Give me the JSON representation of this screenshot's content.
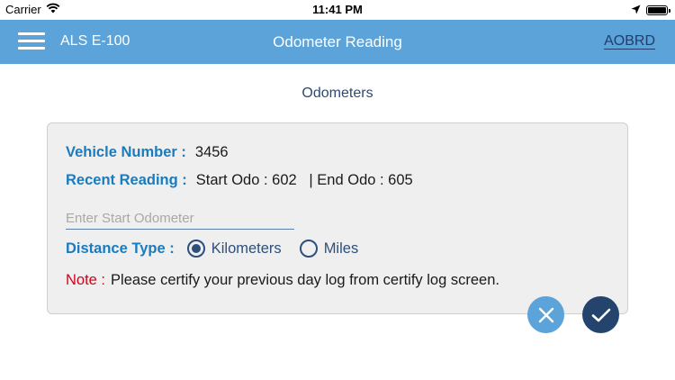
{
  "status_bar": {
    "carrier": "Carrier",
    "time": "11:41 PM",
    "icons": [
      "wifi-icon",
      "location-arrow-icon",
      "battery-icon"
    ],
    "battery_level": 1.0
  },
  "nav": {
    "menu_icon": "hamburger-menu-icon",
    "app_name": "ALS E-100",
    "title": "Odometer Reading",
    "right_link": "AOBRD"
  },
  "section_title": "Odometers",
  "form": {
    "vehicle_number_label": "Vehicle Number :",
    "vehicle_number_value": "3456",
    "recent_reading_label": "Recent Reading :",
    "recent_reading_value": "Start Odo : 602   | End Odo : 605",
    "start_odometer_placeholder": "Enter Start Odometer",
    "start_odometer_value": "",
    "distance_type_label": "Distance Type :",
    "distance_options": [
      {
        "label": "Kilometers",
        "selected": true
      },
      {
        "label": "Miles",
        "selected": false
      }
    ],
    "note_label": "Note :",
    "note_text": "Please certify your previous day log from certify log screen."
  },
  "actions": {
    "cancel_icon": "close-icon",
    "confirm_icon": "checkmark-icon"
  },
  "colors": {
    "nav_background": "#5ba3d9",
    "label_blue": "#1a7bbf",
    "dark_navy": "#2d4f7c",
    "note_red": "#d0021b",
    "card_background": "#efefef"
  }
}
